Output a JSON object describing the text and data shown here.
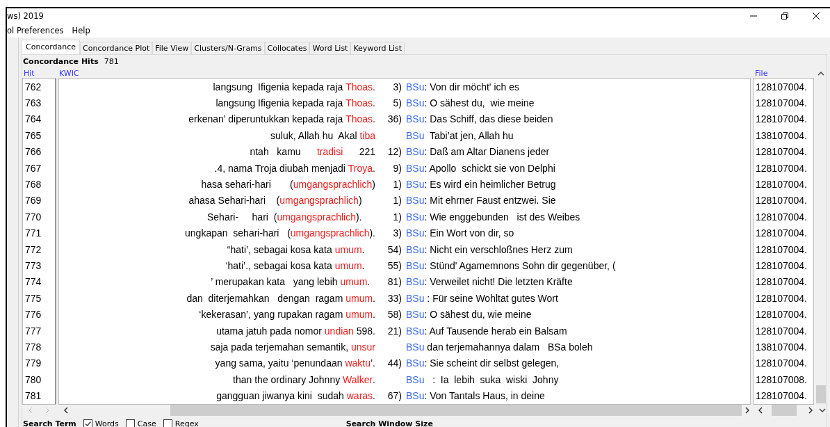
{
  "window": {
    "title": "ws) 2019",
    "menu": [
      "ol Preferences",
      "Help"
    ]
  },
  "tabs": [
    {
      "label": "Concordance",
      "selected": true
    },
    {
      "label": "Concordance Plot",
      "selected": false
    },
    {
      "label": "File View",
      "selected": false
    },
    {
      "label": "Clusters/N-Grams",
      "selected": false
    },
    {
      "label": "Collocates",
      "selected": false
    },
    {
      "label": "Word List",
      "selected": false
    },
    {
      "label": "Keyword List",
      "selected": false
    }
  ],
  "hits": {
    "label": "Concordance Hits",
    "count": "781"
  },
  "columns": [
    "Hit",
    "KWIC",
    "File"
  ],
  "rows": [
    {
      "hit": "762",
      "pre": "langsung  Ifigenia kepada raja ",
      "key": "Thoas",
      "post": ".",
      "num": "3)",
      "term": "BSu",
      "rest": ": Von dir möcht' ich es",
      "file": "128107004."
    },
    {
      "hit": "763",
      "pre": "langsung Ifigenia kepada raja ",
      "key": "Thoas",
      "post": ".",
      "num": "5)",
      "term": "BSu",
      "rest": ": O sähest du,  wie meine",
      "file": "128107004."
    },
    {
      "hit": "764",
      "pre": "erkenan’ diperuntukkan kepada raja ",
      "key": "Thoas",
      "post": ".",
      "num": "36)",
      "term": "BSu",
      "rest": ": Das Schiff, das diese beiden",
      "file": "128107004."
    },
    {
      "hit": "765",
      "pre": "suluk, Allah hu  Akal ",
      "key": "tiba",
      "term": "BSu",
      "rest": "  Tabi’at jen, Allah hu",
      "file": "138107004."
    },
    {
      "hit": "766",
      "pre": "ntah   kamu      ",
      "key": "tradisi",
      "post": "      221",
      "num": "12)",
      "term": "BSu",
      "rest": ": Daß am Altar Dianens jeder",
      "file": "128107004."
    },
    {
      "hit": "767",
      "pre": ".4, nama Troja diubah menjadi ",
      "key": "Troya",
      "post": ".",
      "num": "9)",
      "term": "BSu",
      "rest": ": Apollo  schickt sie von Delphi",
      "file": "128107004."
    },
    {
      "hit": "768",
      "pre": "hasa sehari-hari       (",
      "key": "umgangsprachlich",
      "post": ")",
      "num": "1)",
      "term": "BSu",
      "rest": ": Es wird ein heimlicher Betrug",
      "file": "128107004."
    },
    {
      "hit": "769",
      "pre": "ahasa Sehari-hari    (",
      "key": "umgangsprachlich",
      "post": ")     ",
      "num": "1)",
      "term": "BSu",
      "rest": ": Mit ehrner Faust entzwei. Sie",
      "file": "128107004."
    },
    {
      "hit": "770",
      "pre": "Sehari-     hari  (",
      "key": "umgangsprachlich",
      "post": ").     ",
      "num": "1)",
      "term": "BSu",
      "rest": ": Wie enggebunden   ist des Weibes",
      "file": "128107004."
    },
    {
      "hit": "771",
      "pre": "ungkapan  sehari-hari   (",
      "key": "umgangsprachlich",
      "post": ").",
      "num": "3)",
      "term": "BSu",
      "rest": ": Ein Wort von dir, so",
      "file": "128107004."
    },
    {
      "hit": "772",
      "pre": "“hati’, sebagai kosa kata ",
      "key": "umum",
      "post": ".    ",
      "num": "54)",
      "term": "BSu",
      "rest": ": Nicht ein verschloßnes Herz zum",
      "file": "128107004."
    },
    {
      "hit": "773",
      "pre": "‘hati’., sebagai kosa kata ",
      "key": "umum",
      "post": ".    ",
      "num": "55)",
      "term": "BSu",
      "rest": ": Stünd' Agamemnons Sohn dir gegenüber, (",
      "file": "128107004."
    },
    {
      "hit": "774",
      "pre": "’ merupakan kata   yang lebih ",
      "key": "umum",
      "post": ".  ",
      "num": "81)",
      "term": "BSu",
      "rest": ": Verweilet nicht! Die letzten Kräfte",
      "file": "128107004."
    },
    {
      "hit": "775",
      "pre": "dan  diterjemahkan   dengan  ragam ",
      "key": "umum",
      "post": ".",
      "num": "33)",
      "term": "BSu",
      "rest": " : Für seine Wohltat gutes Wort",
      "file": "128107004."
    },
    {
      "hit": "776",
      "pre": "‘kekerasan’, yang rupakan ragam ",
      "key": "umum",
      "post": ".",
      "num": "58)",
      "term": "BSu",
      "rest": ": O sähest du, wie meine",
      "file": "128107004."
    },
    {
      "hit": "777",
      "pre": "utama jatuh pada nomor ",
      "key": "undian",
      "post": " 598.",
      "num": "21)",
      "term": "BSu",
      "rest": ": Auf Tausende herab ein Balsam",
      "file": "128107004."
    },
    {
      "hit": "778",
      "pre": "saja pada terjemahan semantik, ",
      "key": "unsur",
      "term": "BSu",
      "rest": " dan terjemahannya dalam   BSa boleh",
      "file": "138107004."
    },
    {
      "hit": "779",
      "pre": "yang sama, yaitu ‘penundaan ",
      "key": "waktu",
      "post": "’.",
      "num": "44)",
      "term": "BSu",
      "rest": ": Sie scheint dir selbst gelegen,",
      "file": "128107004."
    },
    {
      "hit": "780",
      "pre": "than the ordinary Johnny ",
      "key": "Walker",
      "post": ".",
      "term": "BSu",
      "rest": "   :  Ia  lebih  suka  wiski  Johny",
      "file": "128107008."
    },
    {
      "hit": "781",
      "pre": "gangguan jiwanya kini  sudah ",
      "key": "waras",
      "post": ".",
      "num": "67)",
      "term": "BSu",
      "rest": ": Von Tantals Haus, in deine",
      "file": "128107004."
    }
  ],
  "search": {
    "label": "Search Term",
    "options": [
      {
        "label": "Words",
        "checked": true
      },
      {
        "label": "Case",
        "checked": false
      },
      {
        "label": "Regex",
        "checked": false
      }
    ],
    "window_size_label": "Search Window Size"
  }
}
